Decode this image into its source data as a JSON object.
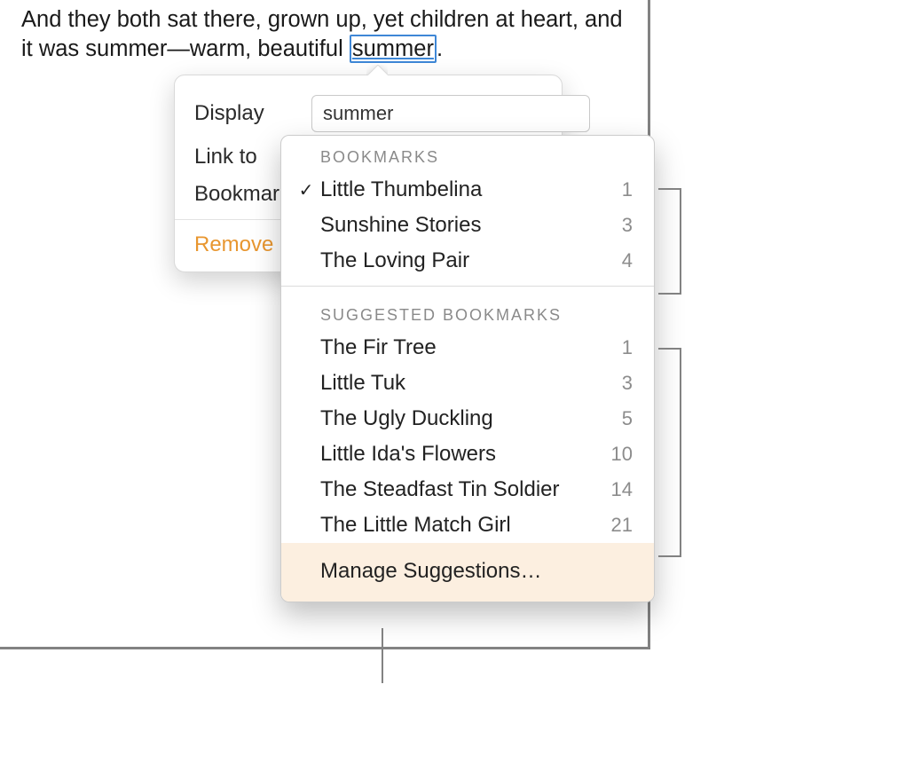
{
  "paragraph": {
    "before": "And they both sat there, grown up, yet children at heart, and it was summer—warm, beautiful ",
    "linked_word": "summer",
    "after": "."
  },
  "popover": {
    "display_label": "Display",
    "display_value": "summer",
    "link_to_label": "Link to",
    "bookmark_label": "Bookmark",
    "remove_label": "Remove"
  },
  "menu": {
    "bookmarks_header": "BOOKMARKS",
    "bookmarks": [
      {
        "name": "Little Thumbelina",
        "count": "1",
        "selected": true
      },
      {
        "name": "Sunshine Stories",
        "count": "3",
        "selected": false
      },
      {
        "name": "The Loving Pair",
        "count": "4",
        "selected": false
      }
    ],
    "suggested_header": "SUGGESTED BOOKMARKS",
    "suggested": [
      {
        "name": "The Fir Tree",
        "count": "1"
      },
      {
        "name": "Little Tuk",
        "count": "3"
      },
      {
        "name": "The Ugly Duckling",
        "count": "5"
      },
      {
        "name": "Little Ida's Flowers",
        "count": "10"
      },
      {
        "name": "The Steadfast Tin Soldier",
        "count": "14"
      },
      {
        "name": "The Little Match Girl",
        "count": "21"
      }
    ],
    "manage_label": "Manage Suggestions…"
  }
}
